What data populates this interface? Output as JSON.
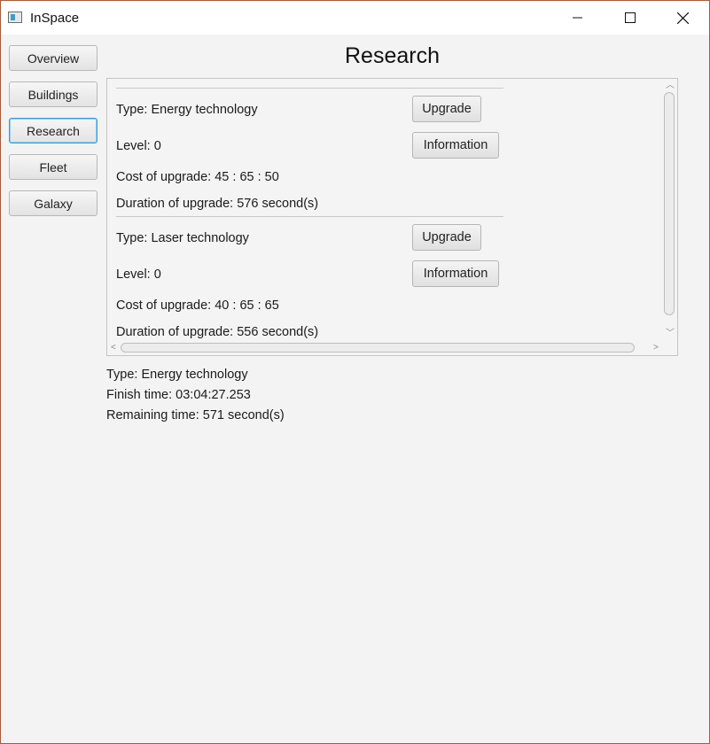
{
  "window": {
    "title": "InSpace"
  },
  "nav": [
    {
      "label": "Overview",
      "active": false
    },
    {
      "label": "Buildings",
      "active": false
    },
    {
      "label": "Research",
      "active": true
    },
    {
      "label": "Fleet",
      "active": false
    },
    {
      "label": "Galaxy",
      "active": false
    }
  ],
  "page": {
    "title": "Research"
  },
  "research_items": [
    {
      "type": "Type: Energy technology",
      "level": "Level: 0",
      "cost": "Cost of upgrade: 45 : 65 : 50",
      "duration": "Duration of upgrade: 576 second(s)",
      "upgrade_label": "Upgrade",
      "info_label": "Information"
    },
    {
      "type": "Type: Laser technology",
      "level": "Level: 0",
      "cost": "Cost of upgrade: 40 : 65 : 65",
      "duration": "Duration of upgrade: 556 second(s)",
      "upgrade_label": "Upgrade",
      "info_label": "Information"
    }
  ],
  "current_research": {
    "type": "Type: Energy technology",
    "finish_time": "Finish time: 03:04:27.253",
    "remaining_time": "Remaining time: 571 second(s)"
  }
}
